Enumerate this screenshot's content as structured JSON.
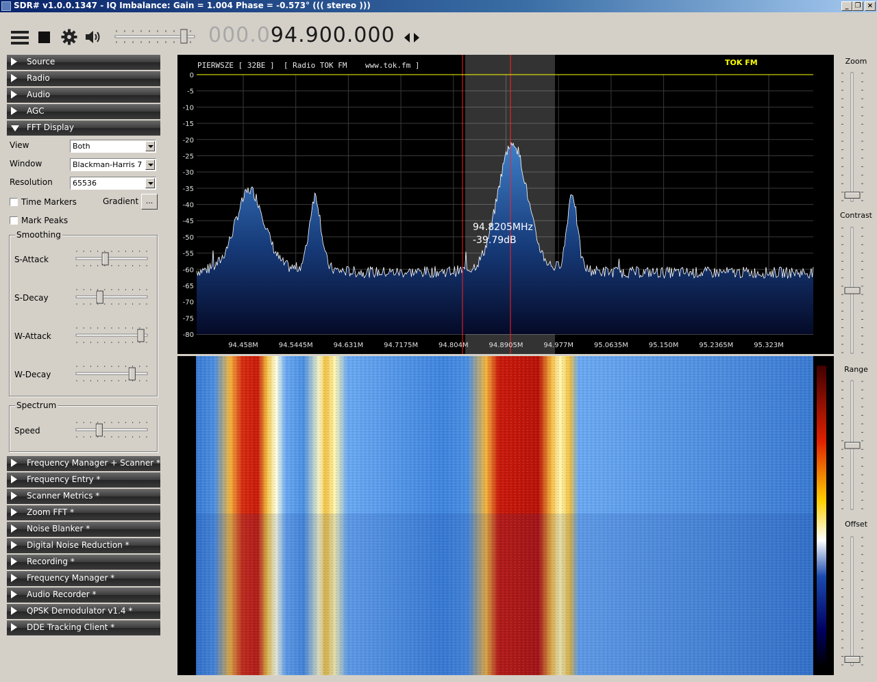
{
  "window": {
    "title": "SDR# v1.0.0.1347 - IQ Imbalance: Gain = 1.004 Phase = -0.573° ((( stereo )))"
  },
  "toolbar": {
    "freq_dim": "000.0",
    "freq_bright": "94.900.000"
  },
  "sections_top": [
    {
      "label": "Source"
    },
    {
      "label": "Radio"
    },
    {
      "label": "Audio"
    },
    {
      "label": "AGC"
    },
    {
      "label": "FFT Display"
    }
  ],
  "fft": {
    "view_label": "View",
    "view_value": "Both",
    "window_label": "Window",
    "window_value": "Blackman-Harris 7",
    "resolution_label": "Resolution",
    "resolution_value": "65536",
    "time_markers_label": "Time Markers",
    "time_markers": false,
    "gradient_label": "Gradient",
    "gradient_button": "...",
    "mark_peaks_label": "Mark Peaks",
    "mark_peaks": false,
    "smoothing_label": "Smoothing",
    "s_attack_label": "S-Attack",
    "s_attack": 0.42,
    "s_decay_label": "S-Decay",
    "s_decay": 0.34,
    "w_attack_label": "W-Attack",
    "w_attack": 0.95,
    "w_decay_label": "W-Decay",
    "w_decay": 0.82,
    "spectrum_label": "Spectrum",
    "speed_label": "Speed",
    "speed": 0.33
  },
  "sections_bottom": [
    {
      "label": "Frequency Manager + Scanner *"
    },
    {
      "label": "Frequency Entry *"
    },
    {
      "label": "Scanner Metrics *"
    },
    {
      "label": "Zoom FFT *"
    },
    {
      "label": "Noise Blanker *"
    },
    {
      "label": "Digital Noise Reduction *"
    },
    {
      "label": "Recording *"
    },
    {
      "label": "Frequency Manager *"
    },
    {
      "label": "Audio Recorder *"
    },
    {
      "label": "QPSK Demodulator v1.4 *"
    },
    {
      "label": "DDE Tracking Client *"
    }
  ],
  "spectrum": {
    "rds_text": "PIERWSZE [ 32BE ]  [ Radio TOK FM    www.tok.fm ]",
    "station": "TOK FM",
    "cursor_freq": "94.8205MHz",
    "cursor_level": "-39.79dB",
    "y_ticks": [
      "0",
      "-5",
      "-10",
      "-15",
      "-20",
      "-25",
      "-30",
      "-35",
      "-40",
      "-45",
      "-50",
      "-55",
      "-60",
      "-65",
      "-70",
      "-75",
      "-80"
    ],
    "x_ticks": [
      "94.458M",
      "94.5445M",
      "94.631M",
      "94.7175M",
      "94.804M",
      "94.8905M",
      "94.977M",
      "95.0635M",
      "95.150M",
      "95.2365M",
      "95.323M"
    ],
    "accent_text": "#ffff00",
    "peak_fill": "#1f5aa0"
  },
  "right": {
    "zoom_label": "Zoom",
    "zoom": 0.02,
    "contrast_label": "Contrast",
    "contrast": 0.5,
    "range_label": "Range",
    "range": 0.5,
    "offset_label": "Offset",
    "offset": 0.02
  }
}
